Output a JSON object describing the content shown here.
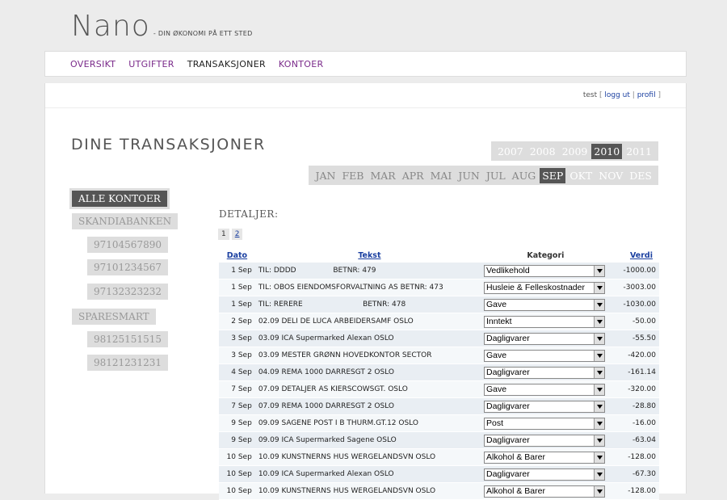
{
  "logo": {
    "title": "Nano",
    "tagline": "- DIN ØKONOMI PÅ ETT STED"
  },
  "nav": [
    {
      "label": "OVERSIKT",
      "active": false
    },
    {
      "label": "UTGIFTER",
      "active": false
    },
    {
      "label": "TRANSAKSJONER",
      "active": true
    },
    {
      "label": "KONTOER",
      "active": false
    }
  ],
  "user": {
    "name": "test",
    "logout": "logg ut",
    "profile": "profil"
  },
  "page_title": "DINE TRANSAKSJONER",
  "years": [
    "2007",
    "2008",
    "2009",
    "2010",
    "2011"
  ],
  "selected_year": "2010",
  "months": [
    "JAN",
    "FEB",
    "MAR",
    "APR",
    "MAI",
    "JUN",
    "JUL",
    "AUG",
    "SEP",
    "OKT",
    "NOV",
    "DES"
  ],
  "selected_month": "SEP",
  "accounts": {
    "all": "ALLE KONTOER",
    "banks": [
      {
        "name": "SKANDIABANKEN",
        "numbers": [
          "97104567890",
          "97101234567",
          "97132323232"
        ]
      },
      {
        "name": "SPARESMART",
        "numbers": [
          "98125151515",
          "98121231231"
        ]
      }
    ]
  },
  "details_label": "DETALJER:",
  "pages": [
    "1",
    "2"
  ],
  "columns": {
    "date": "Dato",
    "text": "Tekst",
    "category": "Kategori",
    "value": "Verdi"
  },
  "transactions": [
    {
      "date": "1 Sep",
      "text": "TIL: DDDD                BETNR: 479",
      "category": "Vedlikehold",
      "value": "-1000.00"
    },
    {
      "date": "1 Sep",
      "text": "TIL: OBOS EIENDOMSFORVALTNING AS BETNR: 473",
      "category": "Husleie & Felleskostnader",
      "value": "-3003.00"
    },
    {
      "date": "1 Sep",
      "text": "TIL: RERERE                          BETNR: 478",
      "category": "Gave",
      "value": "-1030.00"
    },
    {
      "date": "2 Sep",
      "text": "02.09 DELI DE LUCA ARBEIDERSAMF OSLO",
      "category": "Inntekt",
      "value": "-50.00"
    },
    {
      "date": "3 Sep",
      "text": "03.09 ICA Supermarked Alexan OSLO",
      "category": "Dagligvarer",
      "value": "-55.50"
    },
    {
      "date": "3 Sep",
      "text": "03.09 MESTER GRØNN HOVEDKONTOR SECTOR",
      "category": "Gave",
      "value": "-420.00"
    },
    {
      "date": "4 Sep",
      "text": "04.09 REMA 1000 DARRESGT 2 OSLO",
      "category": "Dagligvarer",
      "value": "-161.14"
    },
    {
      "date": "7 Sep",
      "text": "07.09 DETALJER AS KIERSCOWSGT. OSLO",
      "category": "Gave",
      "value": "-320.00"
    },
    {
      "date": "7 Sep",
      "text": "07.09 REMA 1000 DARRESGT 2 OSLO",
      "category": "Dagligvarer",
      "value": "-28.80"
    },
    {
      "date": "9 Sep",
      "text": "09.09 SAGENE POST I B THURM.GT.12 OSLO",
      "category": "Post",
      "value": "-16.00"
    },
    {
      "date": "9 Sep",
      "text": "09.09 ICA Supermarked Sagene OSLO",
      "category": "Dagligvarer",
      "value": "-63.04"
    },
    {
      "date": "10 Sep",
      "text": "10.09 KUNSTNERNS HUS WERGELANDSVN OSLO",
      "category": "Alkohol & Barer",
      "value": "-128.00"
    },
    {
      "date": "10 Sep",
      "text": "10.09 ICA Supermarked Alexan OSLO",
      "category": "Dagligvarer",
      "value": "-67.30"
    },
    {
      "date": "10 Sep",
      "text": "10.09 KUNSTNERNS HUS WERGELANDSVN OSLO",
      "category": "Alkohol & Barer",
      "value": "-128.00"
    }
  ]
}
